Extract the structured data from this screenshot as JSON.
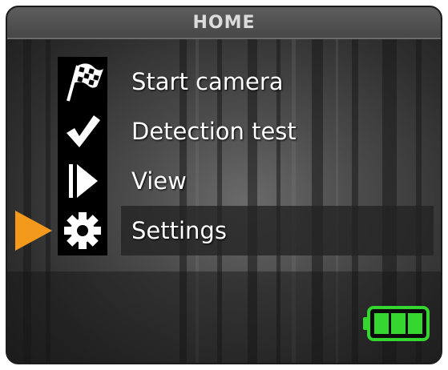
{
  "header": {
    "title": "HOME"
  },
  "menu": {
    "items": [
      {
        "label": "Start camera",
        "icon": "checkered-flag-icon",
        "selected": false
      },
      {
        "label": "Detection test",
        "icon": "checkmark-icon",
        "selected": false
      },
      {
        "label": "View",
        "icon": "play-icon",
        "selected": false
      },
      {
        "label": "Settings",
        "icon": "gear-icon",
        "selected": true
      }
    ]
  },
  "status": {
    "battery_level": 1.0,
    "battery_color": "#35d62f"
  },
  "colors": {
    "cursor": "#f39a1d",
    "header_bg": "#4f4f4f",
    "selection_bg": "#232323"
  }
}
